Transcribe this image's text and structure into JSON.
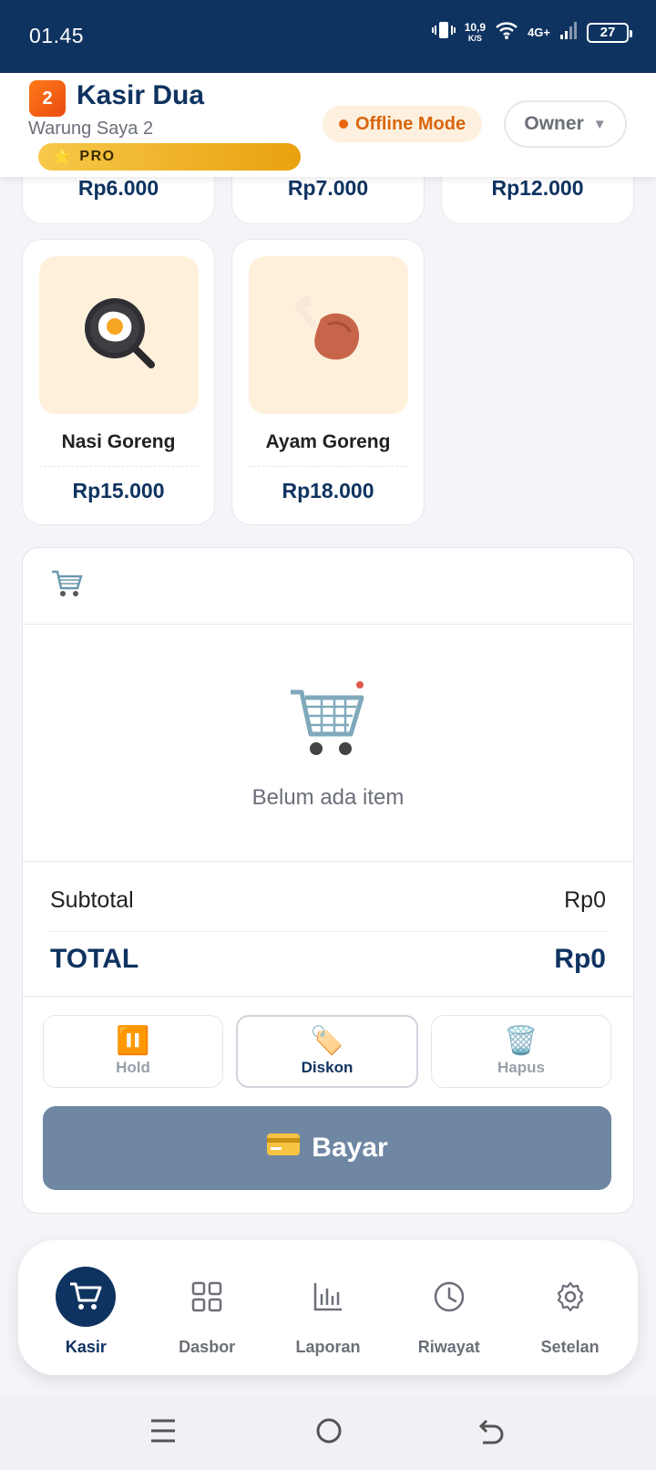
{
  "status_bar": {
    "time": "01.45",
    "speed_value": "10,9",
    "speed_unit": "K/S",
    "network": "4G+",
    "battery": "27"
  },
  "header": {
    "app_title": "Kasir Dua",
    "logo_text": "2",
    "store_name": "Warung Saya 2",
    "pro_label": "PRO",
    "offline_label": "Offline Mode",
    "role_selected": "Owner",
    "colors": {
      "primary": "#0f3360",
      "accent": "#e9660c",
      "pro_gold": "#f2b324"
    }
  },
  "products_partial": [
    {
      "price": "Rp6.000"
    },
    {
      "price": "Rp7.000"
    },
    {
      "price": "Rp12.000"
    }
  ],
  "products": [
    {
      "name": "Nasi Goreng",
      "price": "Rp15.000",
      "icon": "fried-egg-pan-icon"
    },
    {
      "name": "Ayam Goreng",
      "price": "Rp18.000",
      "icon": "chicken-leg-icon"
    }
  ],
  "cart": {
    "empty_text": "Belum ada item",
    "subtotal_label": "Subtotal",
    "subtotal_value": "Rp0",
    "total_label": "TOTAL",
    "total_value": "Rp0",
    "actions": [
      {
        "label": "Hold",
        "icon": "pause-icon"
      },
      {
        "label": "Diskon",
        "icon": "tag-icon"
      },
      {
        "label": "Hapus",
        "icon": "trash-icon"
      }
    ],
    "pay_label": "Bayar"
  },
  "bottom_nav": {
    "items": [
      {
        "label": "Kasir",
        "icon": "cart-icon",
        "active": true
      },
      {
        "label": "Dasbor",
        "icon": "grid-icon"
      },
      {
        "label": "Laporan",
        "icon": "chart-icon"
      },
      {
        "label": "Riwayat",
        "icon": "clock-icon"
      },
      {
        "label": "Setelan",
        "icon": "gear-icon"
      }
    ]
  }
}
